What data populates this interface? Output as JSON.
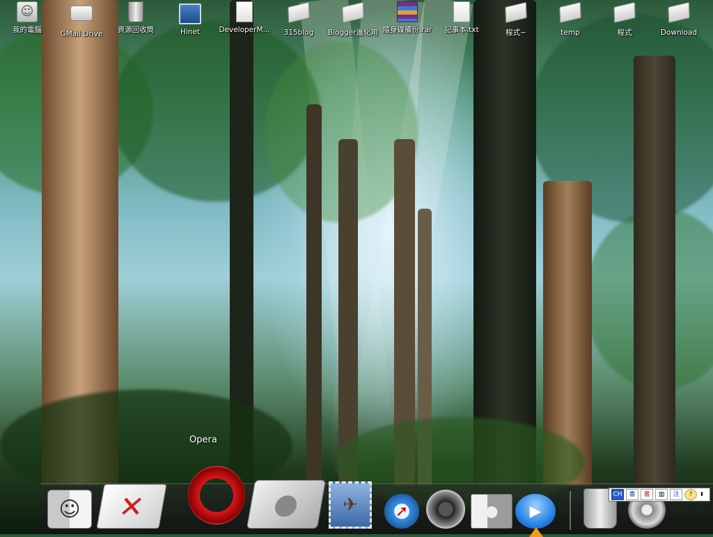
{
  "desktop": {
    "icons": [
      {
        "label": "我的電腦",
        "icon": "my-computer-icon"
      },
      {
        "label": "GMail Drive",
        "icon": "drive-icon"
      },
      {
        "label": "資源回收筒",
        "icon": "recycle-bin-icon"
      },
      {
        "label": "Hinet",
        "icon": "network-icon"
      },
      {
        "label": "DeveloperM...",
        "icon": "document-icon"
      },
      {
        "label": "315blog",
        "icon": "folder-icon"
      },
      {
        "label": "Blogger進化用",
        "icon": "folder-icon"
      },
      {
        "label": "隨身碟備份.rar",
        "icon": "winrar-archive-icon"
      },
      {
        "label": "記事本.txt",
        "icon": "text-file-icon"
      },
      {
        "label": "程式~",
        "icon": "folder-icon"
      },
      {
        "label": "temp",
        "icon": "folder-icon"
      },
      {
        "label": "程式",
        "icon": "folder-icon"
      },
      {
        "label": "Download",
        "icon": "folder-icon"
      }
    ]
  },
  "dock": {
    "hover_label": "Opera",
    "items": [
      {
        "name": "Finder",
        "icon": "finder-icon"
      },
      {
        "name": "Script Editor",
        "icon": "script-editor-icon"
      },
      {
        "name": "Opera",
        "icon": "opera-icon"
      },
      {
        "name": "Apple Folder",
        "icon": "apple-folder-icon"
      },
      {
        "name": "Mail",
        "icon": "mail-stamp-icon"
      },
      {
        "name": "Safari",
        "icon": "safari-compass-icon"
      },
      {
        "name": "Speaker",
        "icon": "speaker-icon"
      },
      {
        "name": "Boot Camp",
        "icon": "switch-icon"
      },
      {
        "name": "iChat",
        "icon": "ichat-video-icon"
      },
      {
        "name": "Trash",
        "icon": "trash-icon"
      },
      {
        "name": "System Preferences",
        "icon": "system-preferences-icon"
      }
    ]
  },
  "ime_bar": {
    "lang": "CH",
    "buttons": [
      "書",
      "書",
      "注",
      "?"
    ]
  }
}
